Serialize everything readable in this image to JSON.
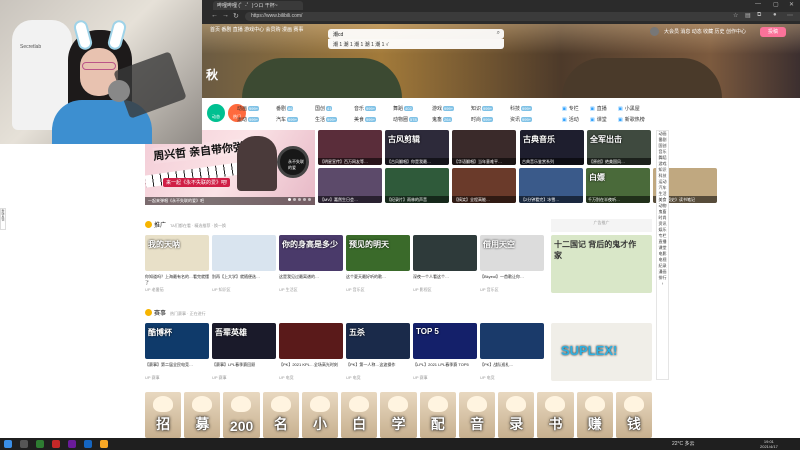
{
  "browser": {
    "tab_title": "哔哩哔哩 (゜-゜)つロ 干杯~",
    "address": "https://www.bilibili.com/",
    "search_query": "潮cd"
  },
  "webcam": {
    "chair_brand": "Secretlab"
  },
  "site": {
    "logo_text": "秋",
    "top_nav": "首页  番剧  直播  游戏中心  会员购  漫画  赛事",
    "search_suggest": "潮  1  潮  1  潮  1  潮  1  潮  1  √",
    "user_nav": "大会员  消息  动态  收藏  历史  创作中心",
    "upload_label": "投稿"
  },
  "channels": {
    "dynamic_label": "动态",
    "hot_label": "热门",
    "items": [
      {
        "label": "动画",
        "count": "999+"
      },
      {
        "label": "番剧",
        "count": "86"
      },
      {
        "label": "国创",
        "count": "41"
      },
      {
        "label": "音乐",
        "count": "999+"
      },
      {
        "label": "舞蹈",
        "count": "402"
      },
      {
        "label": "游戏",
        "count": "999+"
      },
      {
        "label": "知识",
        "count": "999+"
      },
      {
        "label": "科技",
        "count": "999+"
      },
      {
        "label": "运动",
        "count": "999+"
      },
      {
        "label": "汽车",
        "count": "999+"
      },
      {
        "label": "生活",
        "count": "999+"
      },
      {
        "label": "美食",
        "count": "999+"
      },
      {
        "label": "动物圈",
        "count": "578"
      },
      {
        "label": "鬼畜",
        "count": "264"
      },
      {
        "label": "时尚",
        "count": "999+"
      },
      {
        "label": "资讯",
        "count": "999+"
      }
    ],
    "right_links": [
      "专栏",
      "直播",
      "小黑屋",
      "活动",
      "课堂",
      "新歌热榜"
    ]
  },
  "carousel": {
    "headline": "周兴哲 亲自带你弹唱！",
    "badge": "来一起《永不失联的爱》吧!",
    "record_text": "永不失联的爱",
    "caption": "一起来弹唱《永不失联的爱》吧"
  },
  "top_grid": [
    {
      "cap": "【明星宣传】百万网友等…",
      "color": "#5a2d3a",
      "big": ""
    },
    {
      "cap": "【古风翻唱】你是我最…",
      "color": "#2d2a3a",
      "big": "古风剪辑"
    },
    {
      "cap": "【华语翻唱】当年意难平…",
      "color": "#3a2a2a",
      "big": ""
    },
    {
      "cap": "古典音乐鉴赏系列",
      "color": "#1e1e2e",
      "big": "古典音乐"
    },
    {
      "cap": "【原创】绝美国风…",
      "color": "#3f4a3f",
      "big": "全军出击"
    },
    {
      "cap": "【MV】嘉然生日会…",
      "color": "#5c4a6a",
      "big": ""
    },
    {
      "cap": "【纪录片】雨林的声音",
      "color": "#2f5a3a",
      "big": ""
    },
    {
      "cap": "【搞笑】全程高能…",
      "color": "#6a3a2a",
      "big": ""
    },
    {
      "cap": "【2分钟看完】冰雪…",
      "color": "#3a5a8a",
      "big": ""
    },
    {
      "cap": "千万别在半夜听…",
      "color": "#4a6a3a",
      "big": "白嫖"
    },
    {
      "cap": "《人类简史》读书笔记",
      "color": "#c0a880",
      "big": ""
    }
  ],
  "sec1": {
    "title": "推广",
    "sub": "TA们都在看 · 精选推荐 · 换一换",
    "ad": "广告推广"
  },
  "row1": [
    {
      "title": "你知道吗？上海最有名的…看完就懂了",
      "meta": "UP 老番茄",
      "color": "#e8e0c8",
      "big": "我的天呐"
    },
    {
      "title": "别再【上大学】就随便选…",
      "meta": "UP 知识区",
      "color": "#d9e4ef",
      "big": ""
    },
    {
      "title": "这是我见过最离谱的…",
      "meta": "UP 生活区",
      "color": "#4a3a6a",
      "big": "你的身高是多少"
    },
    {
      "title": "这个夏天最好听的歌…",
      "meta": "UP 音乐区",
      "color": "#3a6a2a",
      "big": "预见的明天"
    },
    {
      "title": "深夜一个人看这个…",
      "meta": "UP 影视区",
      "color": "#2e3a3a",
      "big": ""
    },
    {
      "title": "【Bkyeol】一首歌让你…",
      "meta": "UP 音乐区",
      "color": "#dcdcdc",
      "big": "借用天空"
    }
  ],
  "ad_right": {
    "big": "十二国记 背后的鬼才作家",
    "color": "#d9e7c8"
  },
  "sec2": {
    "title": "赛事",
    "sub": "热门赛事 · 正在进行"
  },
  "row2": [
    {
      "title": "【赛事】第二届全民电竞…",
      "meta": "UP 赛事",
      "color": "#0f3a6a",
      "big": "酷博杯"
    },
    {
      "title": "【赛事】LPL春季赛回顾",
      "meta": "UP 赛事",
      "color": "#1a1a2a",
      "big": "吾辈英雄"
    },
    {
      "title": "【PK】2021 KPL…全场高光时刻",
      "meta": "UP 电竞",
      "color": "#5a1a1a",
      "big": ""
    },
    {
      "title": "【PK】第一人称…这波操作",
      "meta": "UP 电竞",
      "color": "#1a2a4a",
      "big": "五杀"
    },
    {
      "title": "【LPL】2021 LPL春季赛 TOP5",
      "meta": "UP 赛事",
      "color": "#14206a",
      "big": "TOP 5"
    },
    {
      "title": "【PK】战队巡礼…",
      "meta": "UP 电竞",
      "color": "#1a3a6a",
      "big": ""
    }
  ],
  "ad_right2": {
    "big": "SUPLEX!",
    "color": "#f0eee8"
  },
  "side_strip": [
    "动画",
    "番剧",
    "国创",
    "音乐",
    "舞蹈",
    "游戏",
    "知识",
    "科技",
    "运动",
    "汽车",
    "生活",
    "美食",
    "动物",
    "鬼畜",
    "时尚",
    "资讯",
    "娱乐",
    "专栏",
    "直播",
    "课堂",
    "电影",
    "电视",
    "纪录",
    "漫画",
    "排行",
    "↑"
  ],
  "left_strip": "新版反馈",
  "recruit": [
    "招",
    "募",
    "200",
    "名",
    "小",
    "白",
    "学",
    "配",
    "音",
    "录",
    "书",
    "赚",
    "钱"
  ],
  "taskbar": {
    "weather": "22°C 多云",
    "time": "19:01",
    "date": "2021/4/17"
  }
}
